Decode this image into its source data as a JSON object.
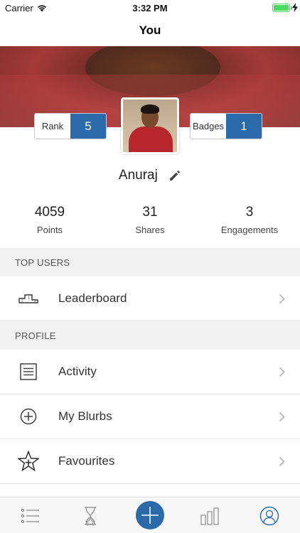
{
  "status_bar": {
    "carrier": "Carrier",
    "time": "3:32 PM"
  },
  "nav": {
    "title": "You"
  },
  "profile": {
    "name": "Anuraj",
    "rank": {
      "label": "Rank",
      "value": "5"
    },
    "badges": {
      "label": "Badges",
      "value": "1"
    }
  },
  "stats": [
    {
      "value": "4059",
      "label": "Points"
    },
    {
      "value": "31",
      "label": "Shares"
    },
    {
      "value": "3",
      "label": "Engagements"
    }
  ],
  "sections": {
    "top_users": {
      "header": "TOP USERS",
      "items": [
        {
          "label": "Leaderboard",
          "icon": "podium-icon"
        }
      ]
    },
    "profile": {
      "header": "PROFILE",
      "items": [
        {
          "label": "Activity",
          "icon": "list-icon"
        },
        {
          "label": "My Blurbs",
          "icon": "plus-circle-icon"
        },
        {
          "label": "Favourites",
          "icon": "star-plus-icon"
        }
      ]
    }
  },
  "tabbar": {
    "tabs": [
      "list-tab-icon",
      "hourglass-tab-icon",
      "add-tab-icon",
      "chart-tab-icon",
      "profile-tab-icon"
    ],
    "accent": "#2a6aa8"
  }
}
